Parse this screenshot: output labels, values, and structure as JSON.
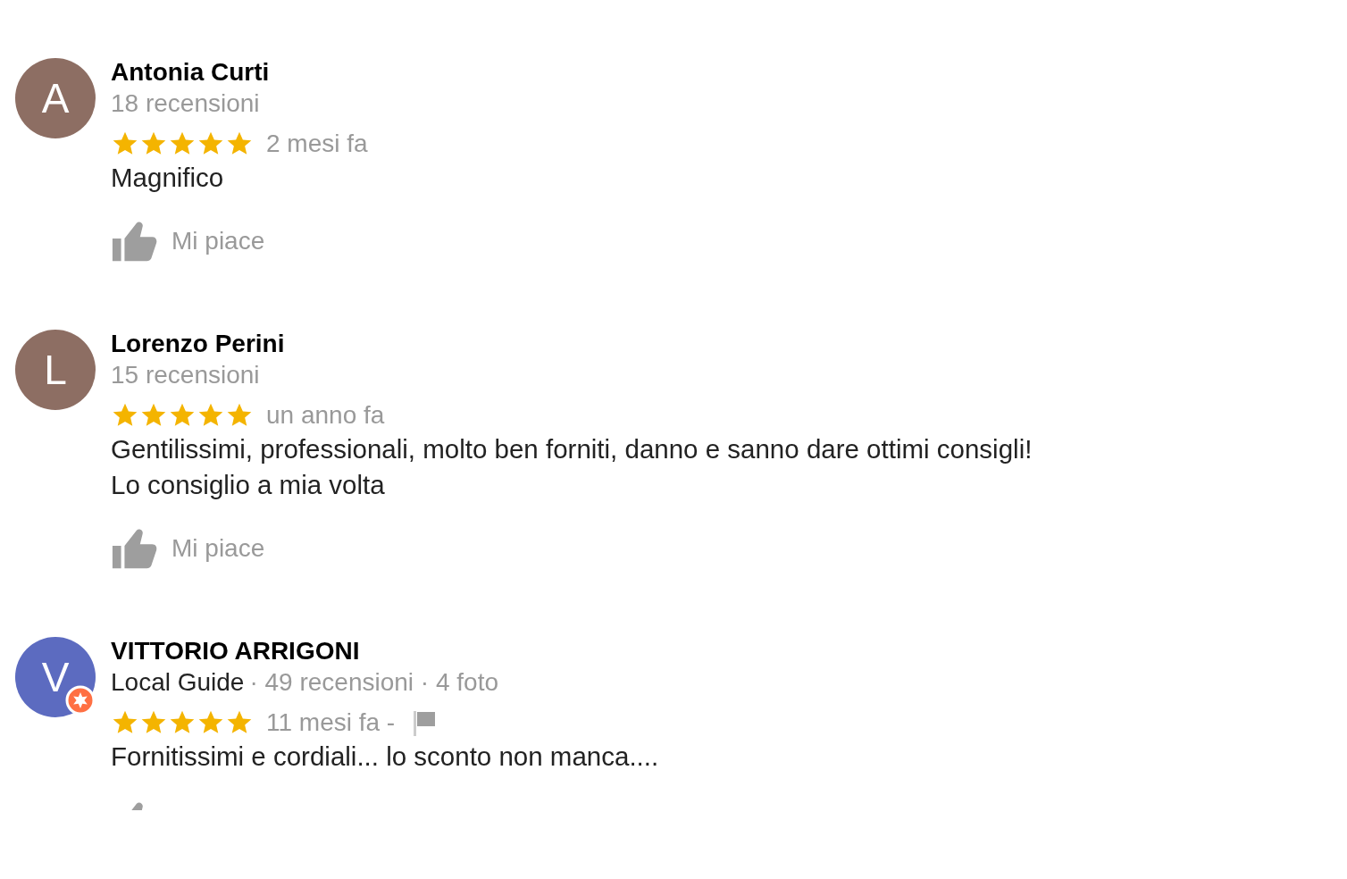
{
  "reviews": [
    {
      "initial": "A",
      "color": "#8d6e63",
      "local_guide_badge": false,
      "name": "Antonia Curti",
      "counts": "18 recensioni",
      "stars": 5,
      "date": "2 mesi fa",
      "report_flag": false,
      "text": "Magnifico",
      "like": {
        "label": "Mi piace"
      }
    },
    {
      "initial": "L",
      "color": "#8d6e63",
      "local_guide_badge": false,
      "name": "Lorenzo Perini",
      "counts": "15 recensioni",
      "stars": 5,
      "date": "un anno fa",
      "report_flag": false,
      "text": "Gentilissimi, professionali, molto ben forniti, danno e sanno dare ottimi consigli!\nLo consiglio a mia volta",
      "like": {
        "label": "Mi piace"
      }
    },
    {
      "initial": "V",
      "color": "#5c6bc0",
      "local_guide_badge": true,
      "name": "VITTORIO ARRIGONI",
      "local_guide": "Local Guide",
      "counts": "· 49 recensioni · 4 foto",
      "stars": 5,
      "date": "11 mesi fa -",
      "report_flag": true,
      "text": "Fornitissimi e cordiali... lo sconto non manca....",
      "like": {
        "cut_off": true
      }
    }
  ]
}
